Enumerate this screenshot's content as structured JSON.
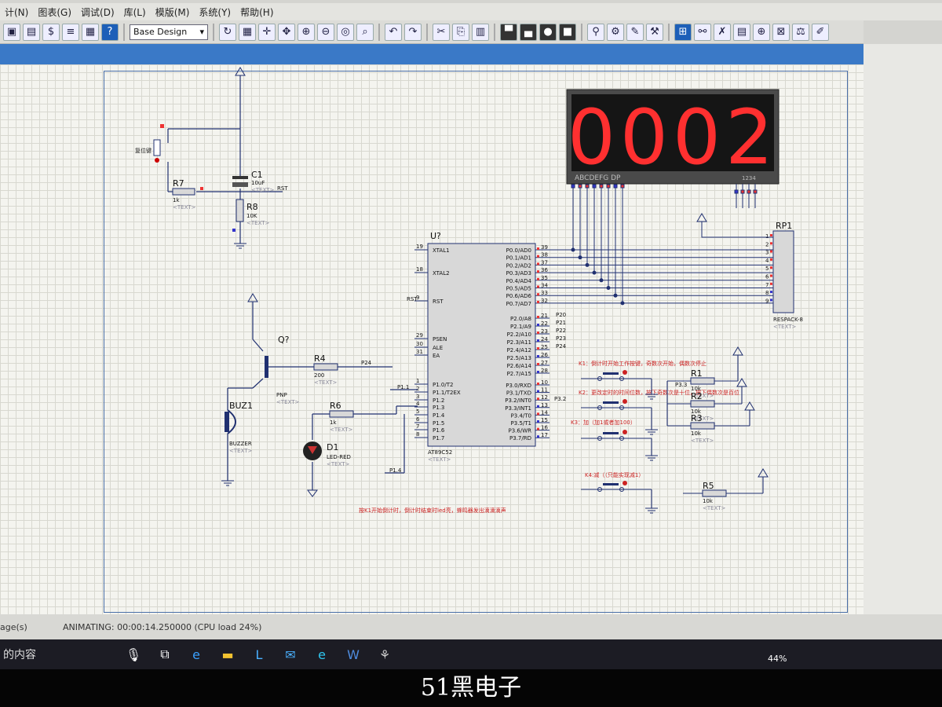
{
  "menu": [
    "计(N)",
    "图表(G)",
    "调试(D)",
    "库(L)",
    "模版(M)",
    "系统(Y)",
    "帮助(H)"
  ],
  "toolbar": {
    "layer": "Base Design"
  },
  "display": {
    "digits": "0002",
    "segments_label": "ABCDEFG  DP",
    "digit_label": "1234"
  },
  "components": {
    "c1": "C1",
    "c1_val": "10uF",
    "r7": "R7",
    "r7_val": "1k",
    "r8": "R8",
    "r8_val": "10K",
    "reset_btn": "复位键",
    "rst_net": "RST",
    "u": "U?",
    "mcu": "AT89C52",
    "q": "Q?",
    "pnp": "PNP",
    "r4": "R4",
    "r4_val": "200",
    "p24": "P24",
    "buz": "BUZ1",
    "buzzer": "BUZZER",
    "r6": "R6",
    "r6_val": "1k",
    "d1": "D1",
    "led": "LED-RED",
    "p14": "P1.4",
    "p11": "P1.1",
    "rp1": "RP1",
    "respack": "RESPACK-8",
    "r1": "R1",
    "r2": "R2",
    "r3": "R3",
    "r5": "R5",
    "r_val": "10k",
    "text_tag": "<TEXT>",
    "rst_pin_net": "RST"
  },
  "mcu_left_pins": [
    {
      "n": "19",
      "name": "XTAL1"
    },
    {
      "n": "18",
      "name": "XTAL2"
    },
    {
      "n": "9",
      "name": "RST"
    },
    {
      "n": "29",
      "name": "PSEN"
    },
    {
      "n": "30",
      "name": "ALE"
    },
    {
      "n": "31",
      "name": "EA"
    },
    {
      "n": "1",
      "name": "P1.0/T2"
    },
    {
      "n": "2",
      "name": "P1.1/T2EX"
    },
    {
      "n": "3",
      "name": "P1.2"
    },
    {
      "n": "4",
      "name": "P1.3"
    },
    {
      "n": "5",
      "name": "P1.4"
    },
    {
      "n": "6",
      "name": "P1.5"
    },
    {
      "n": "7",
      "name": "P1.6"
    },
    {
      "n": "8",
      "name": "P1.7"
    }
  ],
  "mcu_right_pins": [
    {
      "n": "39",
      "name": "P0.0/AD0"
    },
    {
      "n": "38",
      "name": "P0.1/AD1"
    },
    {
      "n": "37",
      "name": "P0.2/AD2"
    },
    {
      "n": "36",
      "name": "P0.3/AD3"
    },
    {
      "n": "35",
      "name": "P0.4/AD4"
    },
    {
      "n": "34",
      "name": "P0.5/AD5"
    },
    {
      "n": "33",
      "name": "P0.6/AD6"
    },
    {
      "n": "32",
      "name": "P0.7/AD7"
    },
    {
      "n": "21",
      "name": "P2.0/A8"
    },
    {
      "n": "22",
      "name": "P2.1/A9"
    },
    {
      "n": "23",
      "name": "P2.2/A10"
    },
    {
      "n": "24",
      "name": "P2.3/A11"
    },
    {
      "n": "25",
      "name": "P2.4/A12"
    },
    {
      "n": "26",
      "name": "P2.5/A13"
    },
    {
      "n": "27",
      "name": "P2.6/A14"
    },
    {
      "n": "28",
      "name": "P2.7/A15"
    },
    {
      "n": "10",
      "name": "P3.0/RXD"
    },
    {
      "n": "11",
      "name": "P3.1/TXD"
    },
    {
      "n": "12",
      "name": "P3.2/INT0"
    },
    {
      "n": "13",
      "name": "P3.3/INT1"
    },
    {
      "n": "14",
      "name": "P3.4/T0"
    },
    {
      "n": "15",
      "name": "P3.5/T1"
    },
    {
      "n": "16",
      "name": "P3.6/WR"
    },
    {
      "n": "17",
      "name": "P3.7/RD"
    }
  ],
  "rp_pins": [
    "1",
    "2",
    "3",
    "4",
    "5",
    "6",
    "7",
    "8",
    "9"
  ],
  "p2_nets": [
    "P20",
    "P21",
    "P22",
    "P23",
    "P24"
  ],
  "keys": {
    "k1": "K1：倒计时开始工作按键，奇数次开始，偶数次停止",
    "k2": "K2：更改定时的时间位数，按下奇数次是十位，按下偶数次是百位",
    "k3": "K3：加（加1或者加100）",
    "k4": "K4:减（（只能实现减1）",
    "p33": "P3.3",
    "p32": "P3.2",
    "p11": "P1.1",
    "p14": "P1.4"
  },
  "note": "按K1开始倒计时，倒计时结束时led亮，蜂鸣器发出滴滴滴声",
  "status": {
    "left": "age(s)",
    "animating": "ANIMATING: 00:00:14.250000 (CPU load 24%)"
  },
  "taskbar": {
    "search": "的内容",
    "battery": "44%"
  },
  "watermark": "51黑电子"
}
